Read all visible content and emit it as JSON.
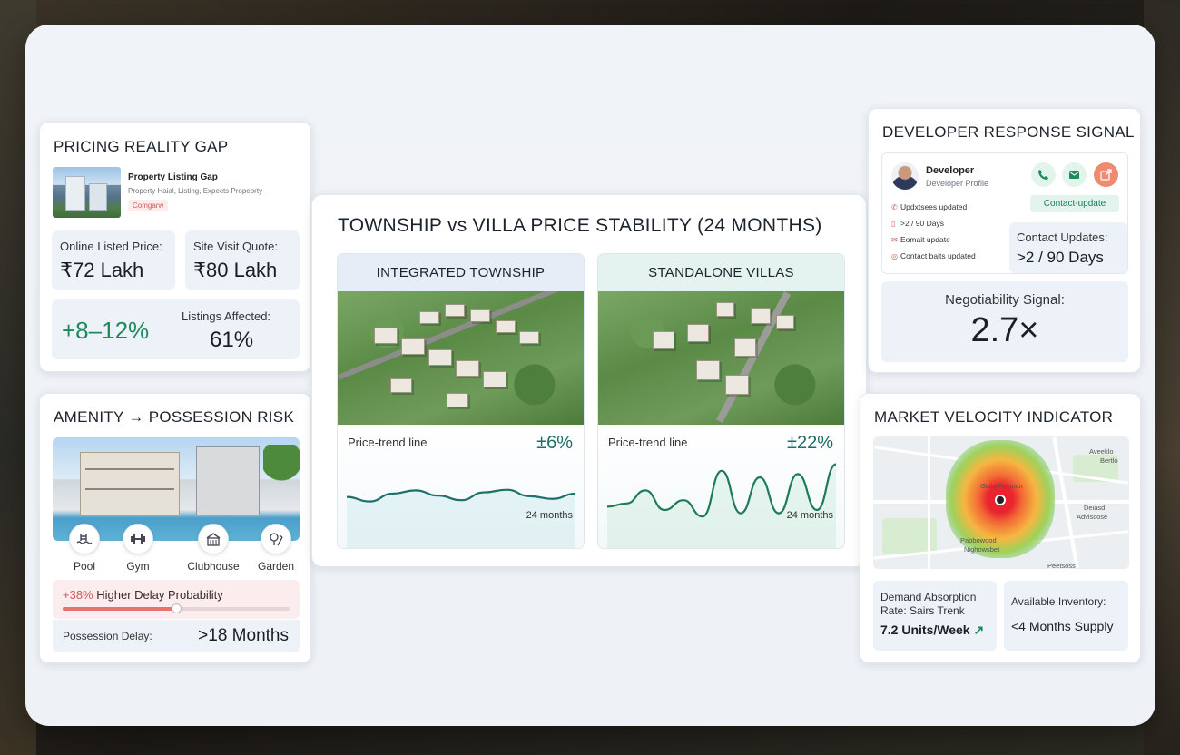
{
  "pricing": {
    "title": "PRICING REALITY GAP",
    "listing_title": "Property Listing Gap",
    "listing_sub": "Property Haial, Listing, Expects Propeorty",
    "listing_badge": "Comgarw",
    "online_label": "Online Listed Price:",
    "online_value": "₹72 Lakh",
    "site_label": "Site Visit Quote:",
    "site_value": "₹80 Lakh",
    "gap_value": "+8–12%",
    "affected_label": "Listings Affected:",
    "affected_value": "61%"
  },
  "amenity": {
    "title": "AMENITY → POSSESSION RISK",
    "items": [
      {
        "label": "Pool",
        "icon": "pool-icon"
      },
      {
        "label": "Gym",
        "icon": "gym-icon"
      },
      {
        "label": "Clubhouse",
        "icon": "clubhouse-icon"
      },
      {
        "label": "Garden",
        "icon": "garden-icon"
      }
    ],
    "delay_pct": "+38%",
    "delay_text": "Higher Delay Probability",
    "delay_level": 0.5,
    "possession_label": "Possession Delay:",
    "possession_value": ">18 Months"
  },
  "center": {
    "title": "TOWNSHIP vs VILLA PRICE STABILITY (24 MONTHS)",
    "columns": [
      {
        "heading": "INTEGRATED TOWNSHIP",
        "trend_label": "Price-trend line",
        "trend_value": "±6%",
        "period": "24 months",
        "series": [
          0.45,
          0.38,
          0.5,
          0.55,
          0.47,
          0.4,
          0.52,
          0.56,
          0.46,
          0.42,
          0.5
        ]
      },
      {
        "heading": "STANDALONE VILLAS",
        "trend_label": "Price-trend line",
        "trend_value": "±22%",
        "period": "24 months",
        "series": [
          0.3,
          0.35,
          0.55,
          0.25,
          0.4,
          0.15,
          0.85,
          0.2,
          0.75,
          0.2,
          0.8,
          0.25,
          0.95
        ]
      }
    ]
  },
  "developer": {
    "title": "DEVELOPER RESPONSE SIGNAL",
    "name": "Developer",
    "profile": "Developer Profile",
    "contact_update": "Contact-update",
    "activity": [
      {
        "icon": "phone-icon",
        "text": "Updxtsees updated"
      },
      {
        "icon": "mobile-icon",
        "text": ">2 / 90 Days"
      },
      {
        "icon": "mail-icon",
        "text": "Eomait update"
      },
      {
        "icon": "target-icon",
        "text": "Contact baits updated"
      }
    ],
    "updates_label": "Contact Updates:",
    "updates_value": ">2 / 90 Days",
    "negotiability_label": "Negotiability Signal:",
    "negotiability_value": "2.7×"
  },
  "velocity": {
    "title": "MARKET VELOCITY INDICATOR",
    "map_labels": [
      "Aveeklo",
      "Bertlo",
      "Deiasd",
      "Adviscose",
      "Guils Porsocn",
      "Pabbowood",
      "Nighowsbet",
      "Peetsoss"
    ],
    "absorption_label": "Demand Absorption Rate: Sairs Trenk",
    "absorption_value": "7.2 Units/Week",
    "inventory_label": "Available Inventory:",
    "inventory_value": "<4 Months Supply"
  }
}
